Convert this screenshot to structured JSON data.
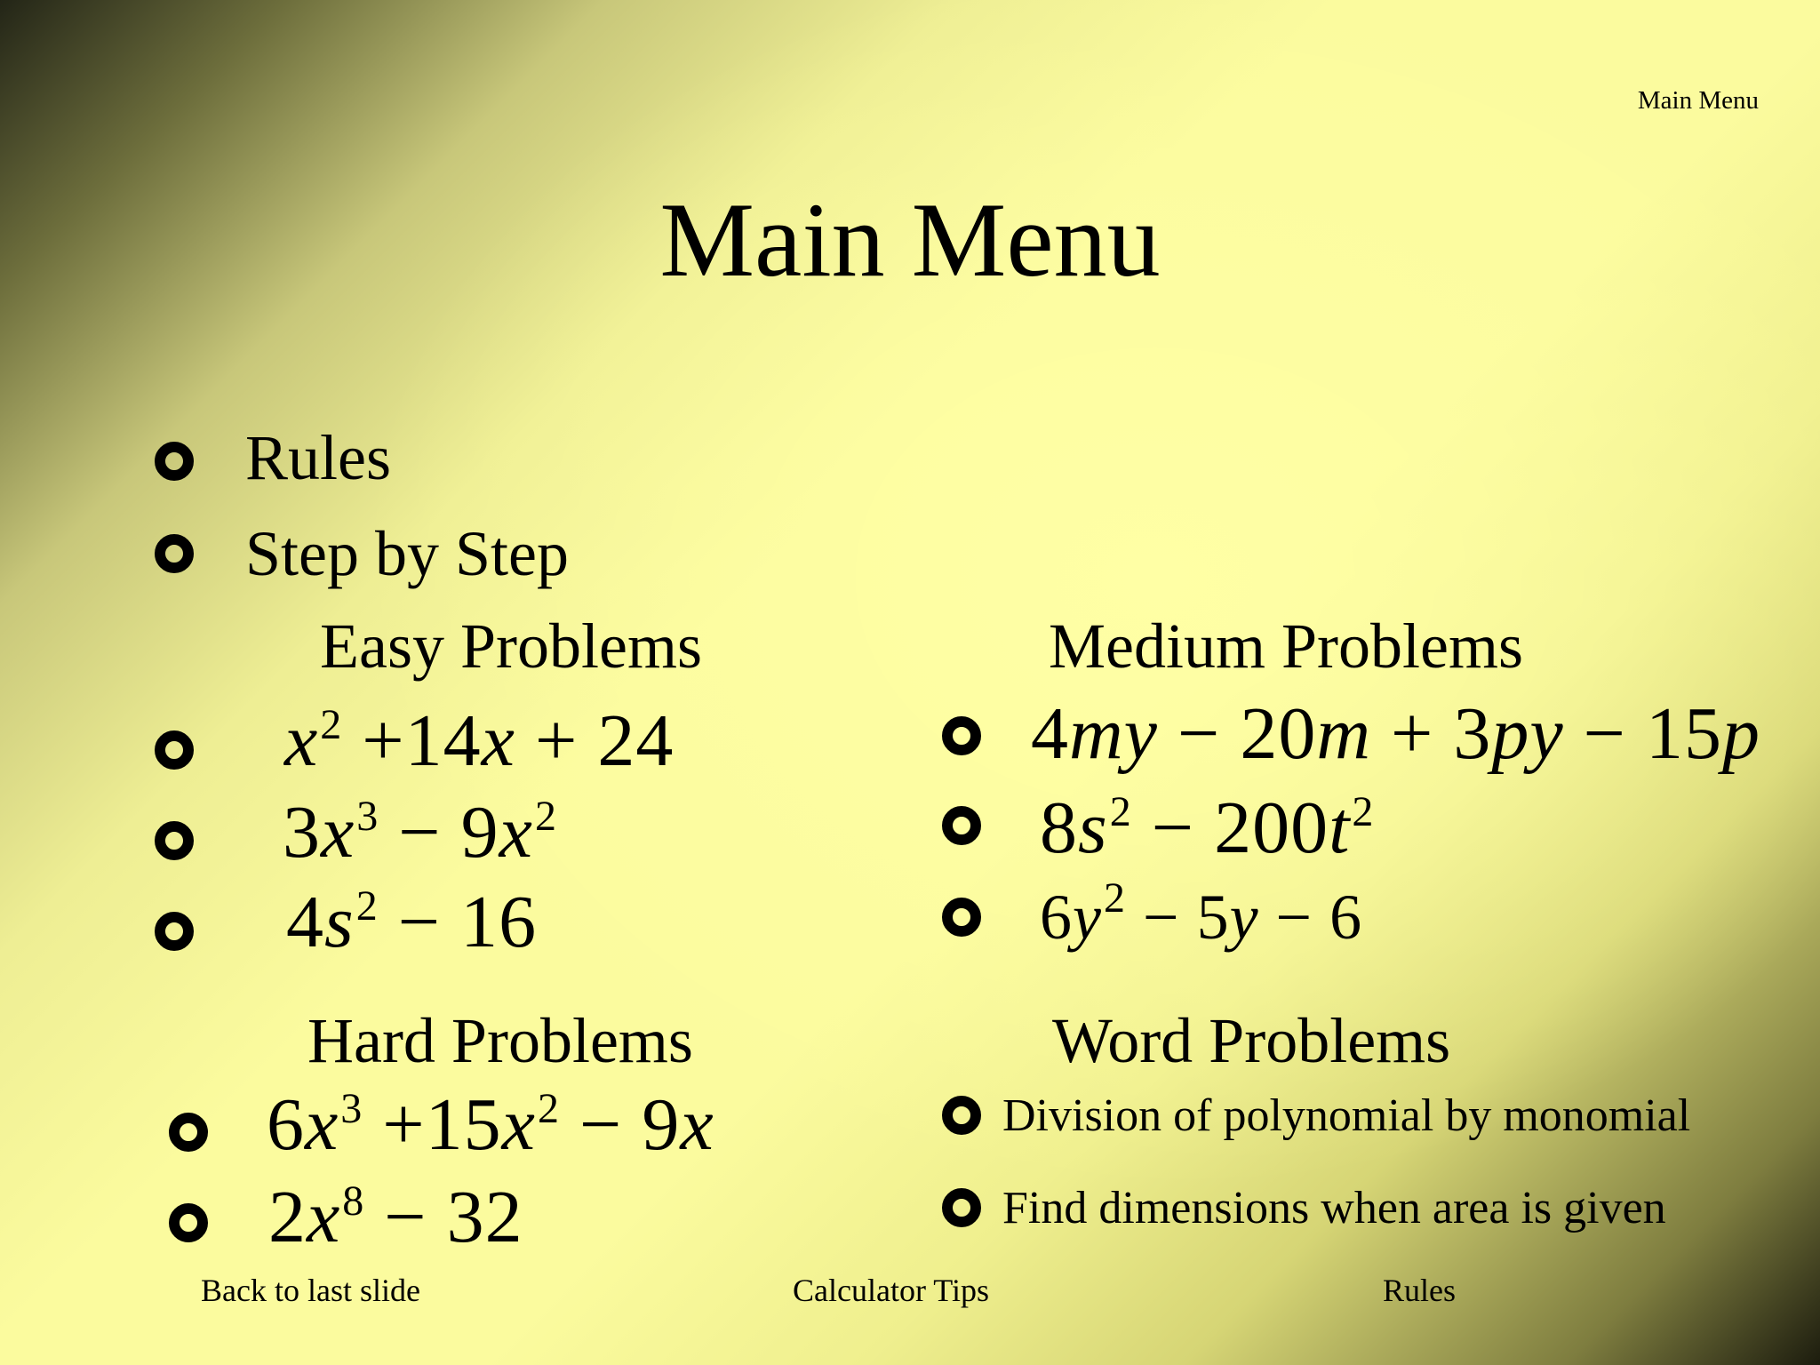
{
  "corner_label": "Main Menu",
  "title": "Main Menu",
  "menu": {
    "rules": "Rules",
    "step_by_step": "Step by Step"
  },
  "sections": {
    "easy": "Easy Problems",
    "medium": "Medium Problems",
    "hard": "Hard Problems",
    "word": "Word Problems"
  },
  "easy": {
    "p1": {
      "t1": "x",
      "e1": "2",
      "t2": " +14",
      "t3": "x",
      "t4": " + 24"
    },
    "p2": {
      "t1": "3",
      "t2": "x",
      "e1": "3",
      "t3": " − 9",
      "t4": "x",
      "e2": "2"
    },
    "p3": {
      "t1": "4",
      "t2": "s",
      "e1": "2",
      "t3": " − 16"
    }
  },
  "medium": {
    "p1": {
      "t1": "4",
      "t2": "my",
      "t3": " − 20",
      "t4": "m",
      "t5": " + 3",
      "t6": "py",
      "t7": " − 15",
      "t8": "p"
    },
    "p2": {
      "t1": "8",
      "t2": "s",
      "e1": "2",
      "t3": " − 200",
      "t4": "t",
      "e2": "2"
    },
    "p3": {
      "t1": "6",
      "t2": "y",
      "e1": "2",
      "t3": " − 5",
      "t4": "y",
      "t5": " − 6"
    }
  },
  "hard": {
    "p1": {
      "t1": "6",
      "t2": "x",
      "e1": "3",
      "t3": " +15",
      "t4": "x",
      "e2": "2",
      "t5": " − 9",
      "t6": "x"
    },
    "p2": {
      "t1": "2",
      "t2": "x",
      "e1": "8",
      "t3": " − 32"
    }
  },
  "word": {
    "p1": "Division of polynomial by monomial",
    "p2": "Find dimensions when area is given"
  },
  "footer": {
    "back": "Back to last slide",
    "calculator": "Calculator Tips",
    "rules": "Rules"
  }
}
